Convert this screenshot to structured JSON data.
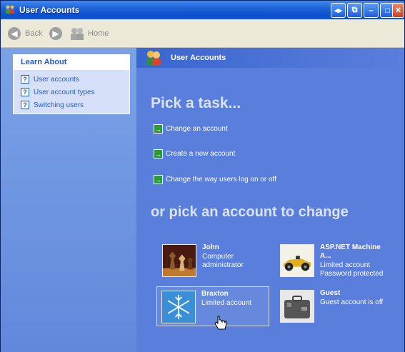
{
  "window": {
    "title": "User Accounts"
  },
  "toolbar": {
    "back_label": "Back",
    "home_label": "Home"
  },
  "learn_about": {
    "header": "Learn About",
    "items": [
      {
        "label": "User accounts"
      },
      {
        "label": "User account types"
      },
      {
        "label": "Switching users"
      }
    ]
  },
  "main": {
    "header_title": "User Accounts",
    "pick_task_heading": "Pick a task...",
    "tasks": [
      {
        "label": "Change an account"
      },
      {
        "label": "Create a new account"
      },
      {
        "label": "Change the way users log on or off"
      }
    ],
    "pick_account_heading": "or pick an account to change",
    "accounts": [
      {
        "name": "John",
        "lines": [
          "Computer",
          "administrator"
        ],
        "icon": "chess-icon"
      },
      {
        "name": "ASP.NET Machine A...",
        "lines": [
          "Limited account",
          "Password protected"
        ],
        "icon": "race-car-icon"
      },
      {
        "name": "Braxton",
        "lines": [
          "Limited account"
        ],
        "icon": "snowflake-icon"
      },
      {
        "name": "Guest",
        "lines": [
          "Guest account is off"
        ],
        "icon": "briefcase-icon"
      }
    ]
  },
  "colors": {
    "accent": "#215dc6",
    "pane_blue": "#5a7edc",
    "task_arrow": "#2f9a35"
  }
}
